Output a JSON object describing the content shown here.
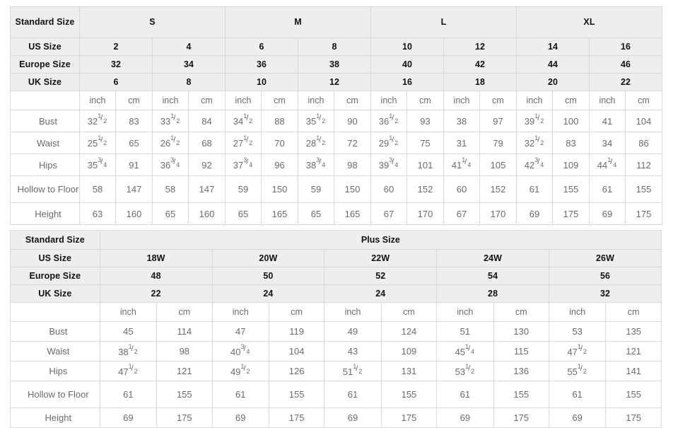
{
  "standard_table": {
    "corner_label": "Standard Size",
    "size_groups": [
      {
        "label": "S",
        "span": 2
      },
      {
        "label": "M",
        "span": 2
      },
      {
        "label": "L",
        "span": 2
      },
      {
        "label": "XL",
        "span": 2
      }
    ],
    "size_rows": [
      {
        "label": "US Size",
        "values": [
          "2",
          "4",
          "6",
          "8",
          "10",
          "12",
          "14",
          "16"
        ]
      },
      {
        "label": "Europe Size",
        "values": [
          "32",
          "34",
          "36",
          "38",
          "40",
          "42",
          "44",
          "46"
        ]
      },
      {
        "label": "UK Size",
        "values": [
          "6",
          "8",
          "10",
          "12",
          "16",
          "18",
          "20",
          "22"
        ]
      }
    ],
    "unit_row": {
      "label": "",
      "units": [
        "inch",
        "cm",
        "inch",
        "cm",
        "inch",
        "cm",
        "inch",
        "cm",
        "inch",
        "cm",
        "inch",
        "cm",
        "inch",
        "cm",
        "inch",
        "cm"
      ]
    },
    "measure_rows": [
      {
        "label": "Bust",
        "values": [
          "32 1/2",
          "83",
          "33 1/2",
          "84",
          "34 1/2",
          "88",
          "35 1/2",
          "90",
          "36 1/2",
          "93",
          "38",
          "97",
          "39 1/2",
          "100",
          "41",
          "104"
        ]
      },
      {
        "label": "Waist",
        "values": [
          "25 1/2",
          "65",
          "26 1/2",
          "68",
          "27 1/2",
          "70",
          "28 1/2",
          "72",
          "29 1/2",
          "75",
          "31",
          "79",
          "32 1/2",
          "83",
          "34",
          "86"
        ]
      },
      {
        "label": "Hips",
        "values": [
          "35 3/4",
          "91",
          "36 3/4",
          "92",
          "37 3/4",
          "96",
          "38 3/4",
          "98",
          "39 3/4",
          "101",
          "41 1/4",
          "105",
          "42 3/4",
          "109",
          "44 1/4",
          "112"
        ]
      },
      {
        "label": "Hollow to Floor",
        "values": [
          "58",
          "147",
          "58",
          "147",
          "59",
          "150",
          "59",
          "150",
          "60",
          "152",
          "60",
          "152",
          "61",
          "155",
          "61",
          "155"
        ]
      },
      {
        "label": "Height",
        "values": [
          "63",
          "160",
          "65",
          "160",
          "65",
          "165",
          "65",
          "165",
          "67",
          "170",
          "67",
          "170",
          "69",
          "175",
          "69",
          "175"
        ]
      }
    ]
  },
  "plus_table": {
    "corner_label": "Standard Size",
    "group_label": "Plus Size",
    "size_rows": [
      {
        "label": "US Size",
        "values": [
          "18W",
          "20W",
          "22W",
          "24W",
          "26W"
        ]
      },
      {
        "label": "Europe Size",
        "values": [
          "48",
          "50",
          "52",
          "54",
          "56"
        ]
      },
      {
        "label": "UK Size",
        "values": [
          "22",
          "24",
          "24",
          "28",
          "32"
        ]
      }
    ],
    "unit_row": {
      "label": "",
      "units": [
        "inch",
        "cm",
        "inch",
        "cm",
        "inch",
        "cm",
        "inch",
        "cm",
        "inch",
        "cm"
      ]
    },
    "measure_rows": [
      {
        "label": "Bust",
        "values": [
          "45",
          "114",
          "47",
          "119",
          "49",
          "124",
          "51",
          "130",
          "53",
          "135"
        ]
      },
      {
        "label": "Waist",
        "values": [
          "38 1/2",
          "98",
          "40 3/4",
          "104",
          "43",
          "109",
          "45 1/4",
          "115",
          "47 1/2",
          "121"
        ]
      },
      {
        "label": "Hips",
        "values": [
          "47 1/2",
          "121",
          "49 1/2",
          "126",
          "51 1/2",
          "131",
          "53 1/2",
          "136",
          "55 1/2",
          "141"
        ]
      },
      {
        "label": "Hollow to Floor",
        "values": [
          "61",
          "155",
          "61",
          "155",
          "61",
          "155",
          "61",
          "155",
          "61",
          "155"
        ]
      },
      {
        "label": "Height",
        "values": [
          "69",
          "175",
          "69",
          "175",
          "69",
          "175",
          "69",
          "175",
          "69",
          "175"
        ]
      }
    ]
  },
  "colors": {
    "header_bg": "#eeeeee",
    "border": "#d9d9d9",
    "header_text": "#111111",
    "data_text": "#6b6b6b",
    "page_bg": "#ffffff"
  }
}
